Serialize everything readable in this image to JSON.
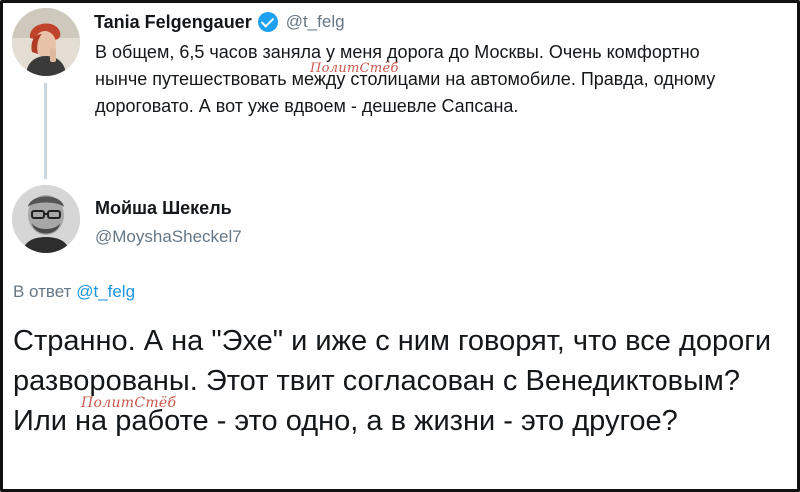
{
  "tweet": {
    "author_name": "Tania Felgengauer",
    "author_handle": "@t_felg",
    "text": "В общем, 6,5 часов заняла у меня дорога до Москвы. Очень комфортно нынче путешествовать между столицами на автомобиле. Правда, одному дороговато. А вот уже вдвоем - дешевле Сапсана."
  },
  "reply": {
    "author_name": "Мойша Шекель",
    "author_handle": "@MoyshaSheckel7",
    "reply_to_prefix": "В ответ",
    "reply_to_handle": "@t_felg",
    "text": "Странно. А на \"Эхе\" и иже с ним говорят, что все дороги разворованы. Этот твит согласован с Венедиктовым? Или на работе - это одно, а в жизни - это другое?"
  },
  "watermarks": [
    "ПолитСтёб",
    "ПолитСтёб"
  ],
  "colors": {
    "link": "#1b95e0",
    "muted": "#657786",
    "verified": "#1da1f2",
    "watermark": "#c0392b"
  },
  "icons": {
    "verified": "verified-badge-icon"
  }
}
